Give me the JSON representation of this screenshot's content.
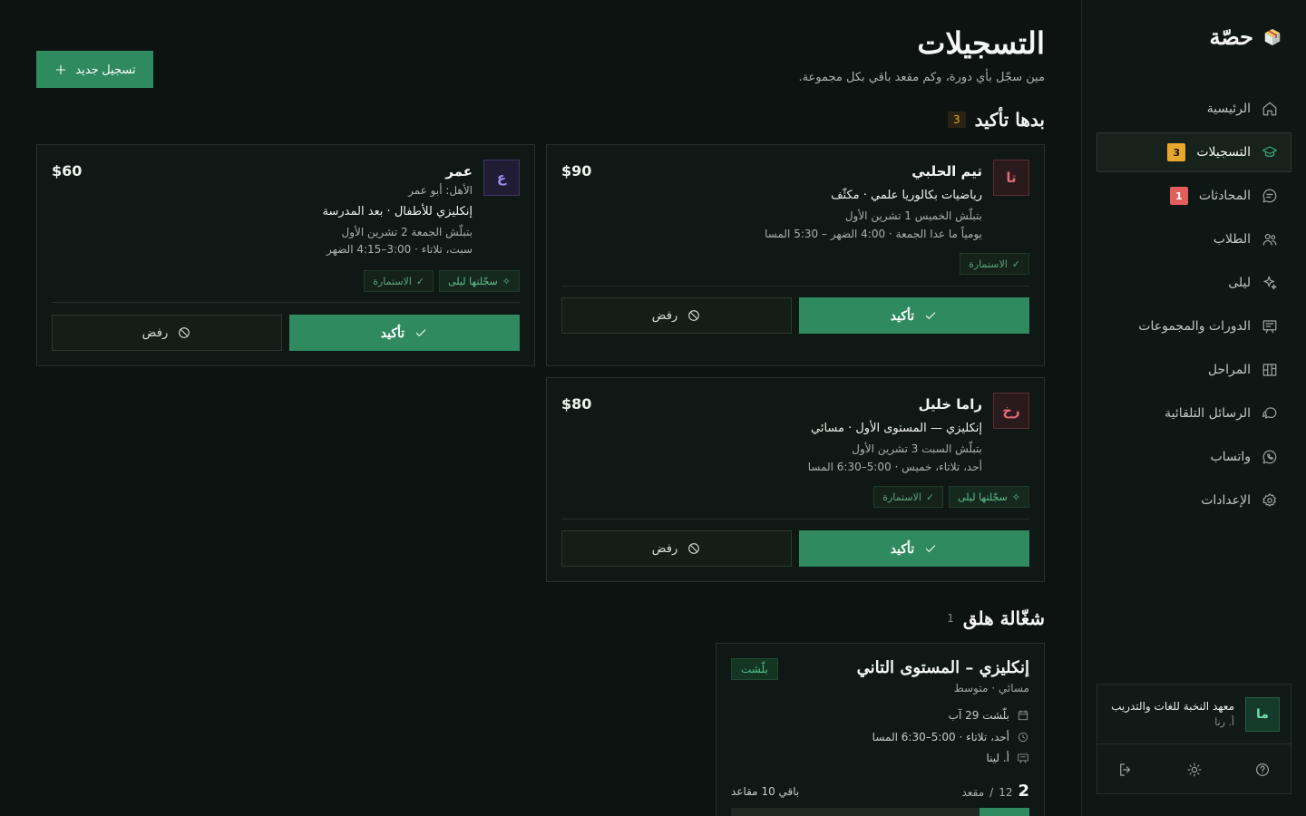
{
  "brand": {
    "name": "حصّة"
  },
  "nav": {
    "items": [
      {
        "label": "الرئيسية"
      },
      {
        "label": "التسجيلات",
        "badge": "3"
      },
      {
        "label": "المحادثات",
        "badge": "1"
      },
      {
        "label": "الطلاب"
      },
      {
        "label": "ليلى"
      },
      {
        "label": "الدورات والمجموعات"
      },
      {
        "label": "المراحل"
      },
      {
        "label": "الرسائل التلقائية"
      },
      {
        "label": "واتساب"
      },
      {
        "label": "الإعدادات"
      }
    ]
  },
  "org": {
    "avatar": "ما",
    "name": "معهد النخبة للغات والتدريب",
    "user": "أ. رنا"
  },
  "page": {
    "title": "التسجيلات",
    "subtitle": "مين سجّل بأي دورة، وكم مقعد باقي بكل مجموعة.",
    "new_button": "تسجيل جديد"
  },
  "pending": {
    "title": "بدها تأكيد",
    "count": "3",
    "confirm_label": "تأكيد",
    "reject_label": "رفض",
    "cards": [
      {
        "avatar": "تا",
        "name": "تيم الحلبي",
        "price": "$90",
        "course": "رياضيات بكالوريا علمي",
        "mode": " · مكثّف",
        "start": "بتبلّش الخميس 1 تشرين الأول",
        "schedule": "يومياً ما عدا الجمعة · 4:00 الضهر – 5:30 المسا",
        "tags": [
          {
            "label": "الاستمارة",
            "kind": "form"
          }
        ]
      },
      {
        "avatar": "ع",
        "name": "عمر",
        "price": "$60",
        "parent": "الأهل: أبو عمر",
        "course": "إنكليزي للأطفال",
        "mode": " · بعد المدرسة",
        "start": "بتبلّش الجمعة 2 تشرين الأول",
        "schedule": "سبت، تلاتاء · 3:00–4:15 الضهر",
        "tags": [
          {
            "label": "سجّلتها ليلى",
            "kind": "ai"
          },
          {
            "label": "الاستمارة",
            "kind": "form"
          }
        ]
      },
      {
        "avatar": "رخ",
        "name": "راما خليل",
        "price": "$80",
        "course": "إنكليزي — المستوى الأول",
        "mode": " · مسائي",
        "start": "بتبلّش السبت 3 تشرين الأول",
        "schedule": "أحد، تلاتاء، خميس · 5:00–6:30 المسا",
        "tags": [
          {
            "label": "سجّلتها ليلى",
            "kind": "ai"
          },
          {
            "label": "الاستمارة",
            "kind": "form"
          }
        ]
      }
    ]
  },
  "groups": {
    "title": "شغّالة هلق",
    "count": "1",
    "items": [
      {
        "title": "إنكليزي – المستوى التاني",
        "level": "مسائي · متوسط",
        "status": "بلّشت",
        "started": "بلّشت 29 آب",
        "schedule": "أحد، تلاتاء · 5:00–6:30 المسا",
        "teacher": "أ. لينا",
        "enrolled": "2",
        "capacity": "12",
        "seat_word": "مقعد",
        "remaining": "باقي 10 مقاعد",
        "fill": 0.1667
      }
    ]
  },
  "colors": {
    "accent": "#2f8a5f",
    "amber": "#e9a72b",
    "danger": "#e35d5d"
  }
}
